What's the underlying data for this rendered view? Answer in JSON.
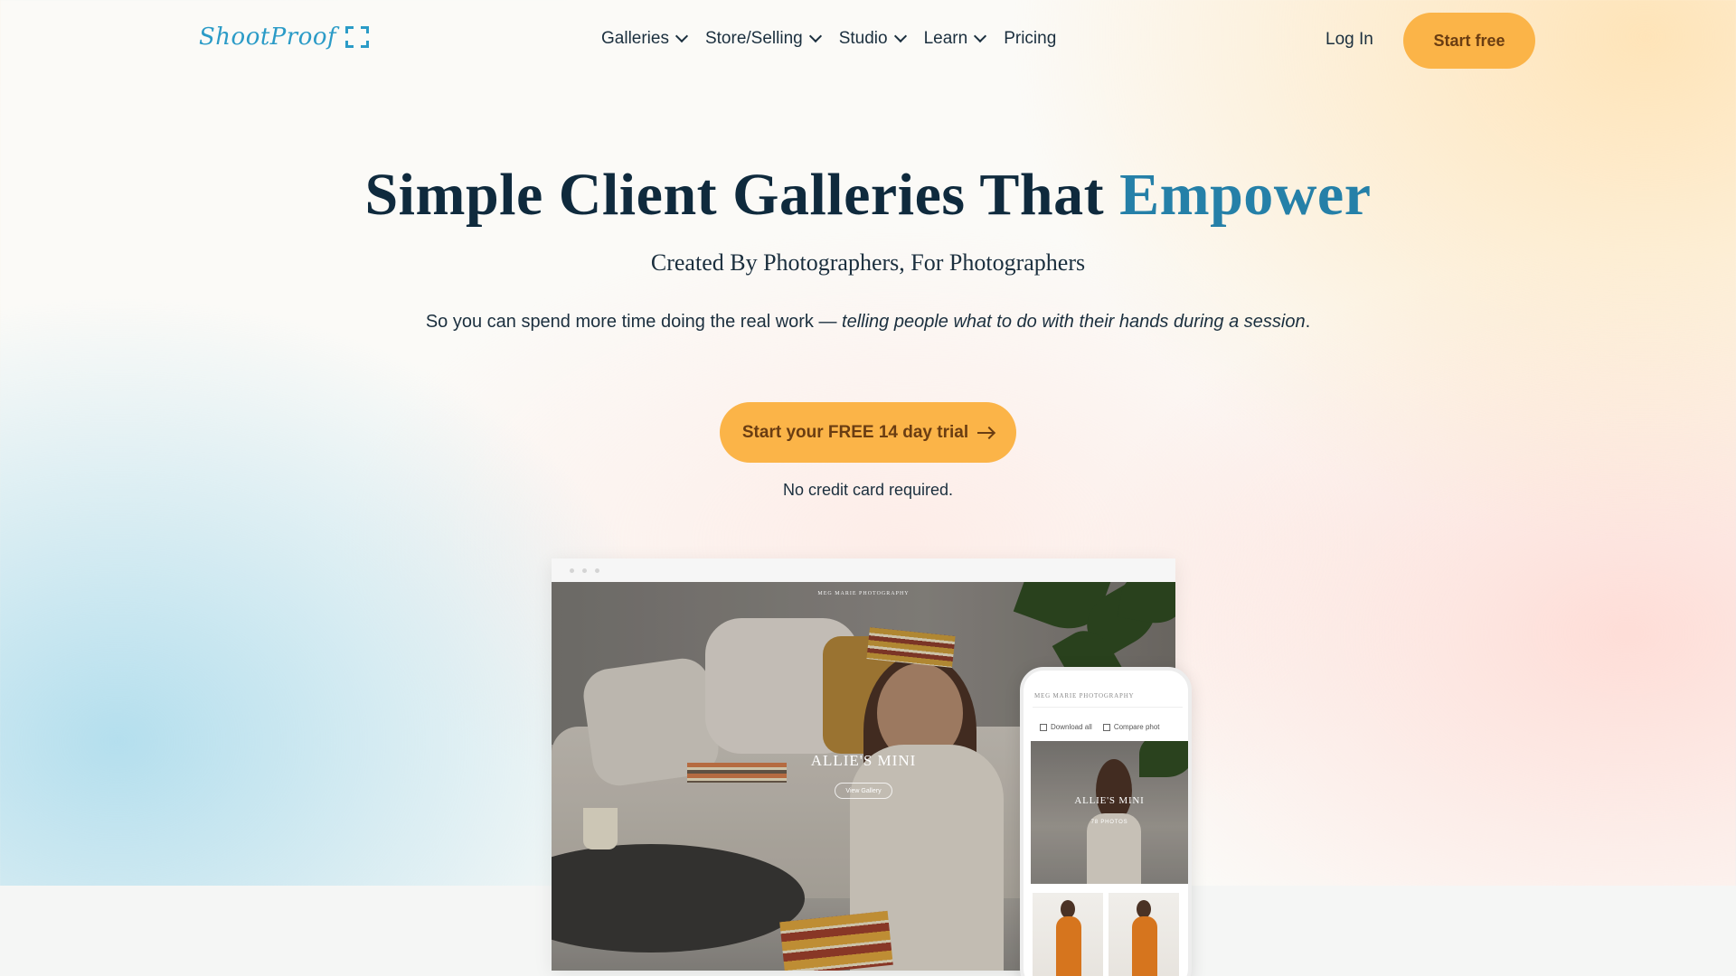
{
  "header": {
    "logo_text": "ShootProof",
    "nav": [
      {
        "label": "Galleries",
        "has_dropdown": true
      },
      {
        "label": "Store/Selling",
        "has_dropdown": true
      },
      {
        "label": "Studio",
        "has_dropdown": true
      },
      {
        "label": "Learn",
        "has_dropdown": true
      },
      {
        "label": "Pricing",
        "has_dropdown": false
      }
    ],
    "login_label": "Log In",
    "start_free_label": "Start free"
  },
  "hero": {
    "title_main": "Simple Client Galleries That",
    "title_accent": "Empower",
    "subtitle": "Created By Photographers, For Photographers",
    "lead_plain": "So you can spend more time doing the real work — ",
    "lead_italic": "telling people what to do with their hands during a session",
    "lead_end": ".",
    "cta_label": "Start your FREE 14 day trial",
    "note": "No credit card required."
  },
  "desktop_mockup": {
    "brand": "MEG MARIE PHOTOGRAPHY",
    "gallery_title": "ALLIE'S MINI",
    "view_gallery_label": "View Gallery"
  },
  "phone_mockup": {
    "brand": "MEG MARIE PHOTOGRAPHY",
    "download_all_label": "Download all",
    "compare_label": "Compare phot",
    "gallery_title": "ALLIE'S MINI",
    "photo_count": "78 PHOTOS"
  },
  "colors": {
    "accent_orange": "#fbb448",
    "brand_blue": "#2b9bc7",
    "title_accent": "#2580a8",
    "text_dark": "#0f2a3d"
  },
  "icons": [
    "chevron-down-icon",
    "arrow-right-icon",
    "download-icon",
    "compare-icon",
    "logo-frame-icon"
  ]
}
